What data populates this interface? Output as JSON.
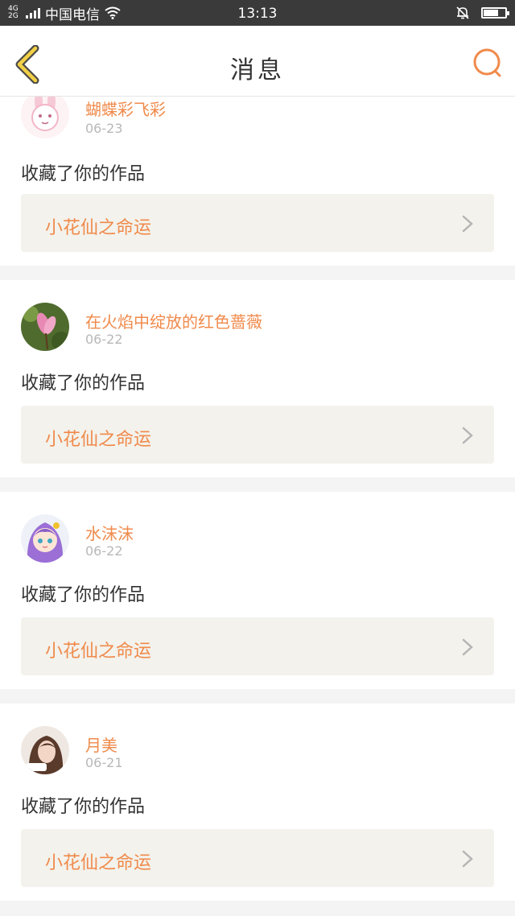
{
  "status_bar": {
    "network": "4G",
    "network2": "2G",
    "carrier": "中国电信",
    "time": "13:13",
    "battery_level": 0.7
  },
  "header": {
    "title": "消息",
    "back_icon": "chevron-left-icon",
    "search_icon": "search-icon"
  },
  "colors": {
    "accent": "#f08a4b",
    "back_arrow": "#f2d046",
    "card_link_bg": "#f3f2ec"
  },
  "messages": [
    {
      "username": "蝴蝶彩飞彩",
      "date": "06-23",
      "action": "收藏了你的作品",
      "work_title": "小花仙之命运"
    },
    {
      "username": "在火焰中绽放的红色蔷薇",
      "date": "06-22",
      "action": "收藏了你的作品",
      "work_title": "小花仙之命运"
    },
    {
      "username": "水沫沫",
      "date": "06-22",
      "action": "收藏了你的作品",
      "work_title": "小花仙之命运"
    },
    {
      "username": "月美",
      "date": "06-21",
      "action": "收藏了你的作品",
      "work_title": "小花仙之命运"
    }
  ]
}
